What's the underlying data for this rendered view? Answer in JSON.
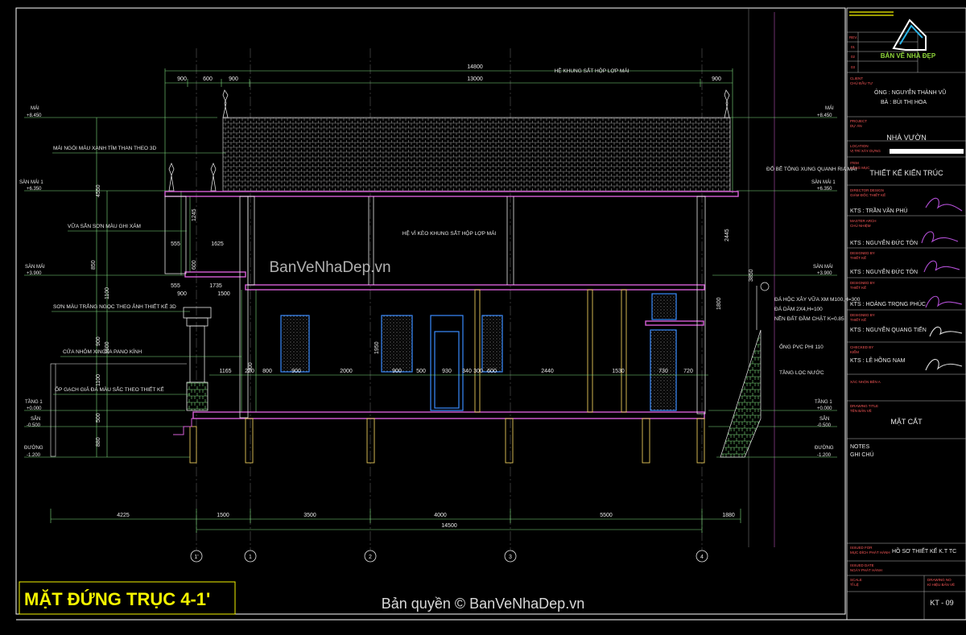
{
  "drawing": {
    "main_title": "MẶT ĐỨNG TRỤC 4-1'",
    "watermark": "BanVeNhaDep.vn",
    "copyright": "Bản quyền © BanVeNhaDep.vn",
    "logo_text": "BẢN VẼ NHÀ ĐẸP",
    "colors": {
      "background": "#000000",
      "title_yellow": "#f5f500",
      "slab": "#d65fd6",
      "column": "#e6c85a",
      "window": "#3a8cff",
      "frame": "#ffffff"
    }
  },
  "levels_left": [
    {
      "name": "MÁI",
      "value": "+8.450"
    },
    {
      "name": "SÀN MÁI 1",
      "value": "+6.350"
    },
    {
      "name": "SÀN MÁI",
      "value": "+3.900"
    },
    {
      "name": "TẦNG 1",
      "value": "+0.000"
    },
    {
      "name": "SÂN",
      "value": "-0.500"
    },
    {
      "name": "ĐƯỜNG",
      "value": "-1.200"
    }
  ],
  "levels_right": [
    {
      "name": "MÁI",
      "value": "+8.450"
    },
    {
      "name": "SÀN MÁI 1",
      "value": "+6.350"
    },
    {
      "name": "SÀN MÁI",
      "value": "+3.900"
    },
    {
      "name": "TẦNG 1",
      "value": "+0.000"
    },
    {
      "name": "SÂN",
      "value": "-0.500"
    },
    {
      "name": "ĐƯỜNG",
      "value": "-1.200"
    }
  ],
  "notes_left": [
    "MÁI NGÓI MÀU XANH TÍM THAN THEO 3D",
    "VỮA SẴN SƠN MÀU GHI XÁM",
    "SƠN MÀU TRẮNG NGỌC THEO ẢNH THIẾT KẾ 3D",
    "CỬA NHÔM XINGFA PANO KÍNH",
    "ỐP GẠCH GIẢ ĐÁ MÀU SẮC THEO THIẾT KẾ"
  ],
  "notes_right": [
    "ĐỔ BÊ TÔNG XUNG QUANH RIA MÁI",
    "ĐÁ HỘC XÂY VỮA XM M100,H=300",
    "ĐÁ DĂM 2X4,H=100",
    "NỀN ĐẤT ĐẦM CHẶT K=0.85",
    "ỐNG PVC PHI 110",
    "TẦNG LỌC NƯỚC"
  ],
  "notes_center": [
    "HỆ KHUNG SẮT HỘP LỢP MÁI",
    "HỆ VÌ KÈO KHUNG SẮT HỘP LỢP MÁI"
  ],
  "dims_top": [
    "14800",
    "900",
    "600",
    "900",
    "13000",
    "900"
  ],
  "dims_bottom": [
    "4225",
    "1500",
    "3500",
    "4000",
    "5500",
    "1880",
    "14500"
  ],
  "dims_openings": [
    "1165",
    "220",
    "800",
    "900",
    "2000",
    "900",
    "500",
    "930",
    "340",
    "300",
    "600",
    "2440",
    "1530",
    "730",
    "720"
  ],
  "dims_vertical": [
    "4550",
    "850",
    "1100",
    "900",
    "1500",
    "1950",
    "1100",
    "500",
    "880",
    "300",
    "2100",
    "2445",
    "1245",
    "3850",
    "1800",
    "600"
  ],
  "dims_small": [
    "555",
    "1625",
    "555",
    "1735",
    "900",
    "1500"
  ],
  "axes": [
    "1'",
    "1",
    "2",
    "3",
    "4"
  ],
  "title_block": {
    "rev_label": "REV.",
    "rev": [
      "01",
      "02",
      "03"
    ],
    "client_label": "CLIENT",
    "client_sub": "CHỦ ĐẦU TƯ",
    "owner1": "ÔNG : NGUYỄN THÀNH VŨ",
    "owner2": "BÀ : BÙI THỊ HOA",
    "project_label": "PROJECT",
    "project_sub": "DỰ ÁN",
    "project": "NHÀ VƯỜN",
    "location_label": "LOCATION",
    "location_sub": "VỊ TRÍ XÂY DỰNG",
    "item_label": "ITEM",
    "item_sub": "HẠNG MỤC",
    "item": "THIẾT KẾ KIẾN TRÚC",
    "director_label": "DIRECTOR DESIGN",
    "director_sub": "GIÁM ĐỐC THIẾT KẾ",
    "director": "KTS : TRẦN VĂN PHÚ",
    "master_label": "MASTER ARCH",
    "master_sub": "CHỦ NHIỆM",
    "master": "KTS : NGUYỄN ĐỨC TÔN",
    "designed_label": "DESIGNED BY",
    "designed_sub": "THIẾT KẾ",
    "designed1": "KTS : NGUYỄN ĐỨC TÔN",
    "designed2": "KTS : HOÀNG TRỌNG PHÚC",
    "designed3": "KTS : NGUYỄN QUANG TIẾN",
    "checked_label": "CHECKED BY",
    "checked_sub": "KIỂM",
    "checked": "KTS : LÊ HỒNG NAM",
    "approved_label": "XÁC NHẬN BÊN A",
    "drawing_title_label": "DRAWING TITLE",
    "drawing_title_sub": "TÊN BẢN VẼ",
    "drawing_title": "MẶT CẮT",
    "notes_label": "NOTES",
    "notes_sub": "GHI CHÚ",
    "issued_label": "ISSUED FOR",
    "issued_sub": "MỤC ĐÍCH PHÁT HÀNH",
    "issued": "HỒ SƠ THIẾT KẾ K.T TC",
    "date_label": "ISSUED DATE",
    "date_sub": "NGÀY PHÁT HÀNH",
    "scale_label": "SCALE",
    "scale_sub": "TỈ LỆ",
    "drawing_no_label": "DRAWING NO",
    "drawing_no_sub": "KÍ HIỆU BẢN VẼ",
    "drawing_no": "KT - 09"
  }
}
